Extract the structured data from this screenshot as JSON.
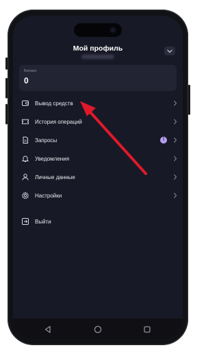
{
  "header": {
    "title": "Мой профиль"
  },
  "balance": {
    "label": "Баланс",
    "value": "0"
  },
  "menu": {
    "items": [
      {
        "label": "Вывод средств",
        "icon": "wallet-icon"
      },
      {
        "label": "История операций",
        "icon": "ticket-icon"
      },
      {
        "label": "Запросы",
        "icon": "document-icon",
        "badge": "!"
      },
      {
        "label": "Уведомления",
        "icon": "bell-icon"
      },
      {
        "label": "Личные данные",
        "icon": "user-icon"
      },
      {
        "label": "Настройки",
        "icon": "gear-icon"
      }
    ],
    "logout_label": "Выйти"
  },
  "colors": {
    "screen_bg": "#181926",
    "card_bg": "#232433",
    "accent": "#b6a1f0",
    "annotation_arrow": "#e0192a"
  }
}
